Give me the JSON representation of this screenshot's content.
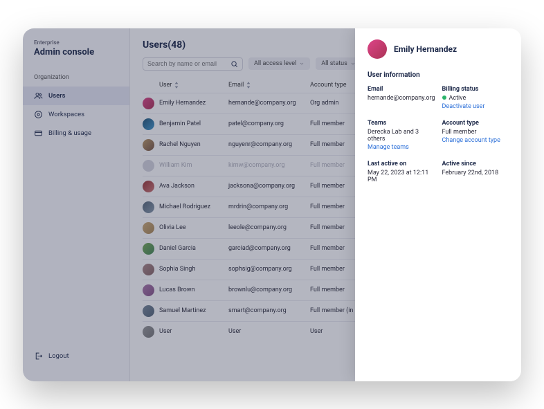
{
  "sidebar": {
    "enterprise_label": "Enterprise",
    "title": "Admin console",
    "section": "Organization",
    "items": [
      {
        "icon": "users-icon",
        "label": "Users"
      },
      {
        "icon": "workspaces-icon",
        "label": "Workspaces"
      },
      {
        "icon": "billing-icon",
        "label": "Billing & usage"
      }
    ],
    "logout": "Logout"
  },
  "main": {
    "heading": "Users(48)",
    "search_placeholder": "Search by name or email",
    "filters": {
      "access": "All access level",
      "status": "All status"
    },
    "columns": {
      "user": "User",
      "email": "Email",
      "account_type": "Account type"
    },
    "rows": [
      {
        "name": "Emily Hernandez",
        "email": "hernande@company.org",
        "type": "Org admin",
        "inactive": false
      },
      {
        "name": "Benjamin Patel",
        "email": "patel@company.org",
        "type": "Full member",
        "inactive": false
      },
      {
        "name": "Rachel Nguyen",
        "email": "nguyenr@company.org",
        "type": "Full member",
        "inactive": false
      },
      {
        "name": "William Kim",
        "email": "kimw@company.org",
        "type": "Full member",
        "inactive": true
      },
      {
        "name": "Ava Jackson",
        "email": "jacksona@company.org",
        "type": "Full member",
        "inactive": false
      },
      {
        "name": "Michael Rodriguez",
        "email": "mrdrin@company.org",
        "type": "Full member",
        "inactive": false
      },
      {
        "name": "Olivia Lee",
        "email": "leeole@company.org",
        "type": "Full member",
        "inactive": false
      },
      {
        "name": "Daniel Garcia",
        "email": "garciad@company.org",
        "type": "Full member",
        "inactive": false
      },
      {
        "name": "Sophia Singh",
        "email": "sophsig@company.org",
        "type": "Full member",
        "inactive": false
      },
      {
        "name": "Lucas Brown",
        "email": "brownlu@company.org",
        "type": "Full member",
        "inactive": false
      },
      {
        "name": "Samuel Martinez",
        "email": "smart@company.org",
        "type": "Full member (in",
        "inactive": false
      },
      {
        "name": "User",
        "email": "User",
        "type": "User",
        "inactive": false
      }
    ]
  },
  "panel": {
    "name": "Emily Hernandez",
    "section": "User information",
    "email_label": "Email",
    "email": "hernande@company.org",
    "billing_label": "Billing status",
    "billing_status": "Active",
    "deactivate_link": "Deactivate user",
    "teams_label": "Teams",
    "teams": "Derecka Lab and 3 others",
    "manage_teams_link": "Manage teams",
    "account_type_label": "Account type",
    "account_type": "Full member",
    "change_type_link": "Change account type",
    "last_active_label": "Last active on",
    "last_active": "May 22, 2023 at 12:11 PM",
    "active_since_label": "Active since",
    "active_since": "February 22nd, 2018"
  }
}
